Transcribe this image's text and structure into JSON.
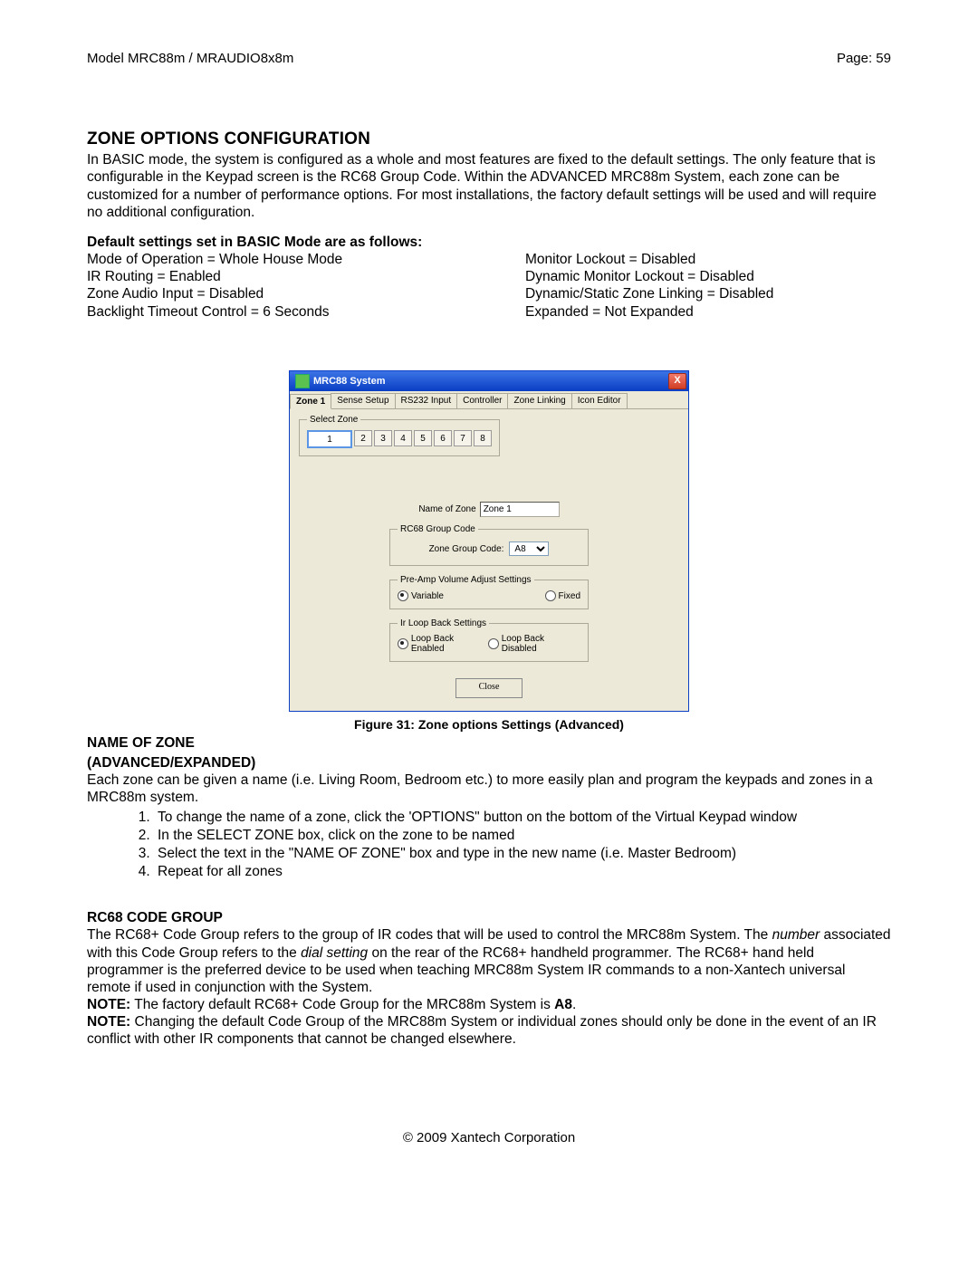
{
  "header": {
    "model": "Model MRC88m / MRAUDIO8x8m",
    "page": "Page: 59"
  },
  "title": "ZONE OPTIONS CONFIGURATION",
  "intro": "In BASIC mode, the system is configured as a whole and most features are fixed to the default settings. The only feature that is configurable in the Keypad screen is the RC68 Group Code. Within the ADVANCED MRC88m System, each zone can be customized for a number of performance options. For most installations, the factory default settings will be used and will require no additional configuration.",
  "defaults_heading": "Default settings set in BASIC Mode are as follows:",
  "defaults_left": [
    "Mode of Operation = Whole House Mode",
    "IR Routing = Enabled",
    "Zone Audio Input = Disabled",
    "Backlight Timeout Control = 6 Seconds"
  ],
  "defaults_right": [
    "Monitor Lockout = Disabled",
    "Dynamic Monitor Lockout = Disabled",
    "Dynamic/Static Zone Linking = Disabled",
    "Expanded = Not Expanded"
  ],
  "window": {
    "title": "MRC88 System",
    "close_x": "X",
    "tabs": [
      "Zone 1",
      "Sense Setup",
      "RS232 Input",
      "Controller",
      "Zone Linking",
      "Icon Editor"
    ],
    "select_zone_legend": "Select Zone",
    "zone_numbers": [
      "1",
      "2",
      "3",
      "4",
      "5",
      "6",
      "7",
      "8"
    ],
    "name_of_zone_label": "Name of Zone",
    "name_of_zone_value": "Zone 1",
    "rc68_legend": "RC68 Group Code",
    "zone_group_code_label": "Zone Group Code:",
    "zone_group_code_value": "A8",
    "preamp_legend": "Pre-Amp Volume Adjust Settings",
    "preamp_variable": "Variable",
    "preamp_fixed": "Fixed",
    "irloop_legend": "Ir Loop Back Settings",
    "irloop_enabled": "Loop Back Enabled",
    "irloop_disabled": "Loop Back Disabled",
    "close_btn": "Close"
  },
  "figure_caption": "Figure 31: Zone options Settings (Advanced)",
  "name_of_zone": {
    "heading1": "NAME OF ZONE",
    "heading2": "(ADVANCED/EXPANDED)",
    "para": "Each zone can be given a name (i.e. Living Room, Bedroom etc.) to more easily plan and program the keypads and zones in a MRC88m system.",
    "steps": [
      "To change the name of a zone, click the 'OPTIONS\" button on the bottom of the Virtual Keypad window",
      "In the SELECT ZONE box, click on the zone to be named",
      "Select the text in the \"NAME OF ZONE\" box and type in the new name (i.e. Master Bedroom)",
      "Repeat for all zones"
    ]
  },
  "rc68": {
    "heading": "RC68 CODE GROUP",
    "p1a": "The RC68+ Code Group refers to the group of IR codes that will be used to control the MRC88m System. The ",
    "p1b": "number",
    "p1c": " associated with this Code Group refers to the ",
    "p1d": "dial setting",
    "p1e": " on the rear of the RC68+ handheld programmer",
    "p1f": ". ",
    "p1g": "The RC68+ hand held programmer is the preferred device to be used when teaching MRC88m System IR commands to a non-Xantech universal remote if used in conjunction with the System.",
    "note1_label": "NOTE:",
    "note1_text": " The factory default RC68+ Code Group for the MRC88m System is ",
    "note1_code": "A8",
    "note1_dot": ".",
    "note2_label": "NOTE:",
    "note2_text": " Changing the default Code Group of the MRC88m System or individual zones should only be done in the event of an IR conflict with other IR components that cannot be changed elsewhere."
  },
  "footer": "© 2009 Xantech Corporation"
}
